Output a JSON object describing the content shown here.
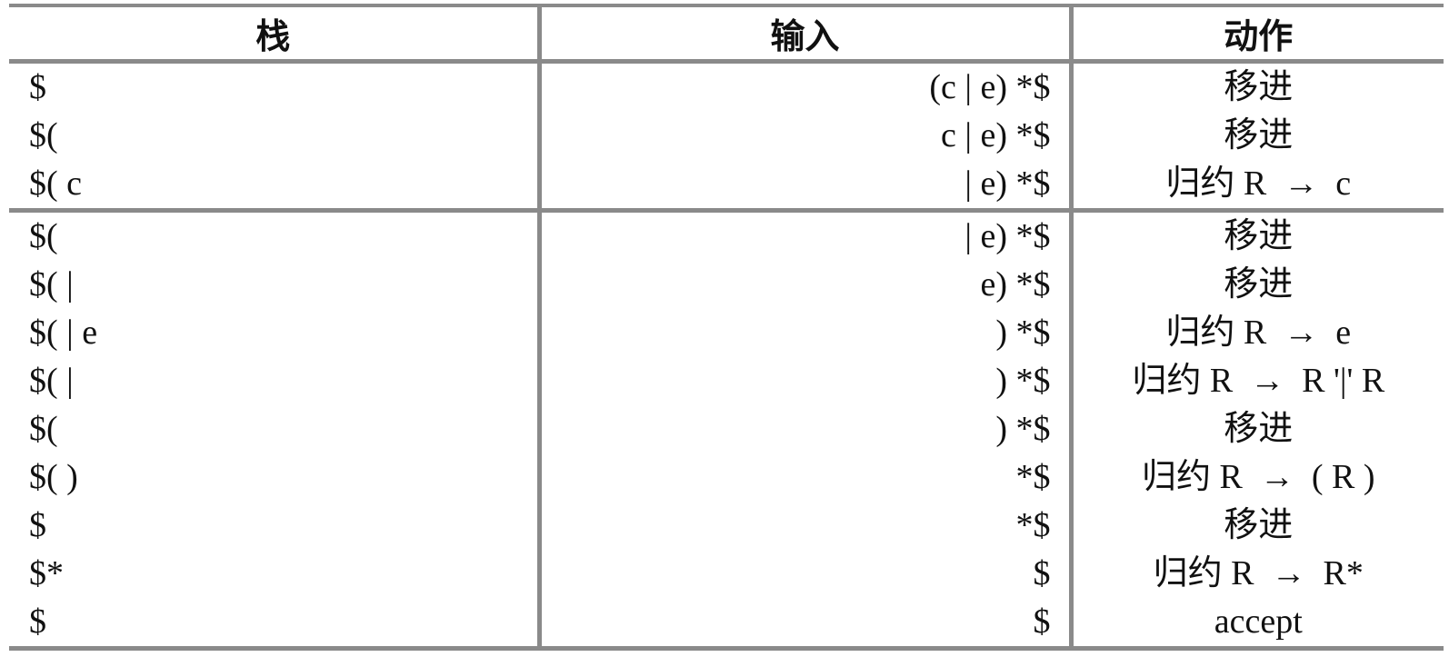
{
  "table": {
    "headers": {
      "stack": "栈",
      "input": "输入",
      "action": "动作"
    },
    "rows": [
      {
        "stack": "$",
        "input": "(c | e) *$",
        "action": "移进"
      },
      {
        "stack": "$(",
        "input": "c | e) *$",
        "action": "移进"
      },
      {
        "stack": "$( c",
        "input": "| e) *$",
        "action": "归约 R  →  c"
      },
      {
        "stack": "$(",
        "input": "| e) *$",
        "action": "移进"
      },
      {
        "stack": "$( |",
        "input": "e) *$",
        "action": "移进"
      },
      {
        "stack": "$( | e",
        "input": ") *$",
        "action": "归约 R  →  e"
      },
      {
        "stack": "$( |",
        "input": ") *$",
        "action": "归约 R  →  R '|' R"
      },
      {
        "stack": "$(",
        "input": ") *$",
        "action": "移进"
      },
      {
        "stack": "$( )",
        "input": "*$",
        "action": "归约 R  →  ( R )"
      },
      {
        "stack": "$",
        "input": "*$",
        "action": "移进"
      },
      {
        "stack": "$*",
        "input": "$",
        "action": "归约 R  →  R*"
      },
      {
        "stack": "$",
        "input": "$",
        "action": "accept"
      }
    ]
  }
}
